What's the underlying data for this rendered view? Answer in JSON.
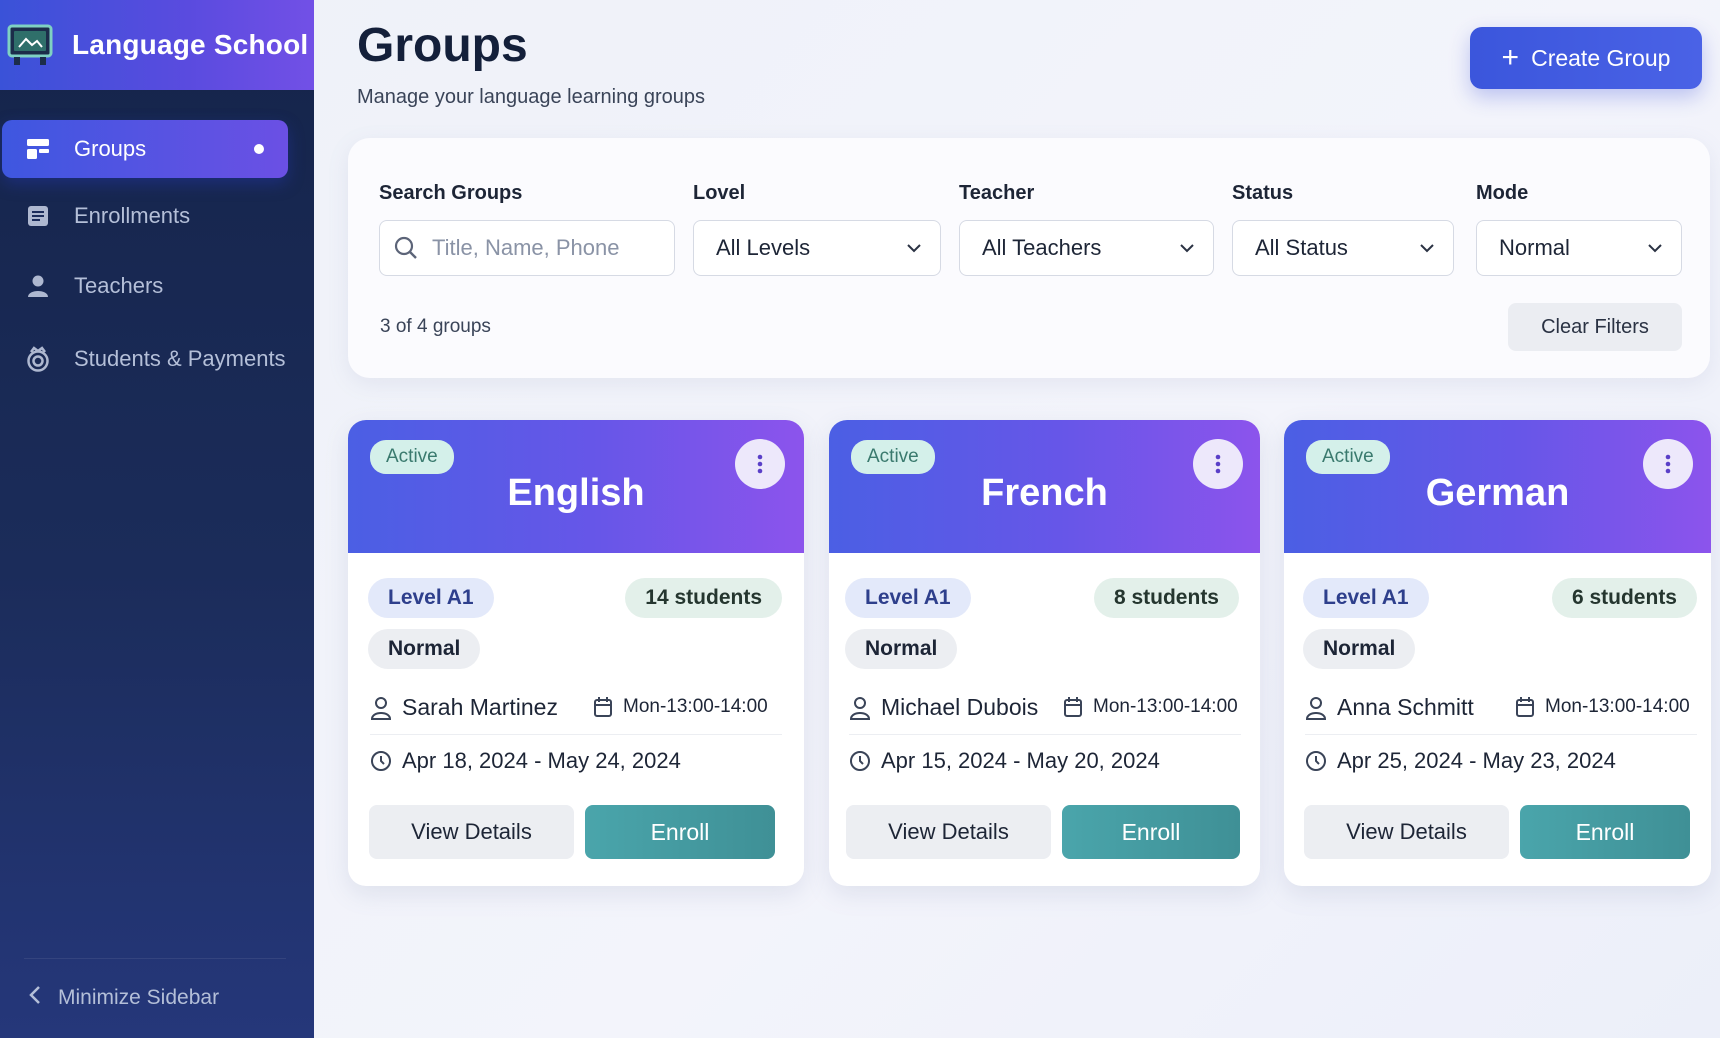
{
  "app": {
    "title": "Language School"
  },
  "sidebar": {
    "items": [
      {
        "label": "Groups",
        "icon": "groups-icon",
        "active": true
      },
      {
        "label": "Enrollments",
        "icon": "enrollments-icon",
        "active": false
      },
      {
        "label": "Teachers",
        "icon": "teacher-icon",
        "active": false
      },
      {
        "label": "Students & Payments",
        "icon": "students-payments-icon",
        "active": false
      }
    ],
    "minimize_label": "Minimize Sidebar"
  },
  "header": {
    "title": "Groups",
    "subtitle": "Manage your language learning groups",
    "create_label": "Create Group"
  },
  "filters": {
    "search": {
      "label": "Search Groups",
      "placeholder": "Title, Name, Phone",
      "value": ""
    },
    "level": {
      "label": "Lovel",
      "value": "All Levels"
    },
    "teacher": {
      "label": "Teacher",
      "value": "All Teachers"
    },
    "status": {
      "label": "Status",
      "value": "All Status"
    },
    "mode": {
      "label": "Mode",
      "value": "Normal"
    },
    "count_text": "3 of 4 groups",
    "clear_label": "Clear Filters"
  },
  "groups": [
    {
      "status": "Active",
      "title": "English",
      "level": "Level A1",
      "students": "14 students",
      "mode": "Normal",
      "teacher": "Sarah Martinez",
      "schedule": "Mon-13:00-14:00",
      "dates": "Apr 18, 2024 - May 24, 2024",
      "view_label": "View Details",
      "enroll_label": "Enroll"
    },
    {
      "status": "Active",
      "title": "French",
      "level": "Level A1",
      "students": "8 students",
      "mode": "Normal",
      "teacher": "Michael Dubois",
      "schedule": "Mon-13:00-14:00",
      "dates": "Apr 15, 2024 - May 20, 2024",
      "view_label": "View Details",
      "enroll_label": "Enroll"
    },
    {
      "status": "Active",
      "title": "German",
      "level": "Level A1",
      "students": "6 students",
      "mode": "Normal",
      "teacher": "Anna Schmitt",
      "schedule": "Mon-13:00-14:00",
      "dates": "Apr 25, 2024 - May 23, 2024",
      "view_label": "View Details",
      "enroll_label": "Enroll"
    }
  ],
  "colors": {
    "accent": "#3b56dc",
    "sidebar": "#1b2c5a",
    "card_header_start": "#4b5fe4",
    "card_header_end": "#8c54ec",
    "enroll": "#4aa5ab",
    "status_badge": "#d4f0ea"
  }
}
